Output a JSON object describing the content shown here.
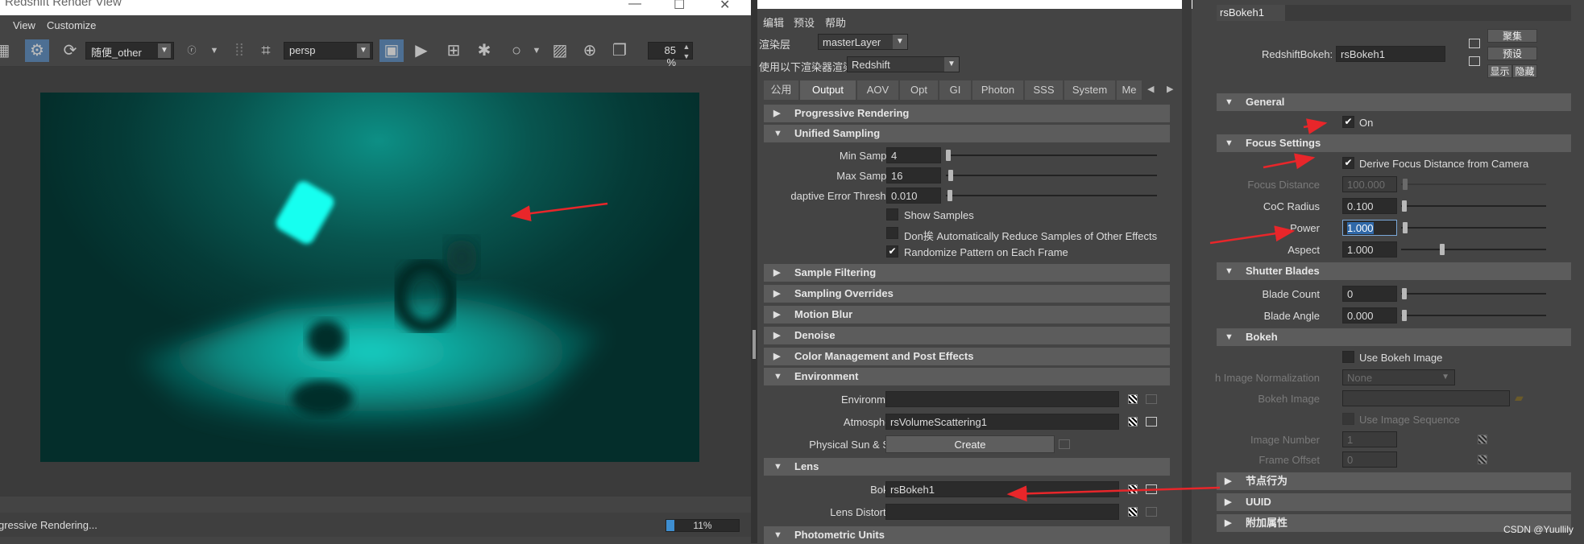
{
  "render_view": {
    "title": "Redshift Render View",
    "menu": [
      "View",
      "Customize"
    ],
    "camera_dropdown": "随便_other",
    "view_dropdown": "persp",
    "zoom": "85 %",
    "status": "gressive Rendering...",
    "progress_label": "11%",
    "progress_value": 0.11
  },
  "render_settings": {
    "menu": [
      "编辑",
      "预设",
      "帮助"
    ],
    "layer_label": "渲染层",
    "layer_value": "masterLayer",
    "renderer_label": "使用以下渲染器渲染",
    "renderer_value": "Redshift",
    "tabs": [
      "公用",
      "Output",
      "AOV",
      "Opt",
      "GI",
      "Photon",
      "SSS",
      "System",
      "Me"
    ],
    "active_tab": "Output",
    "sections": {
      "progressive": "Progressive Rendering",
      "unified": "Unified Sampling",
      "sample_filtering": "Sample Filtering",
      "sampling_overrides": "Sampling Overrides",
      "motion_blur": "Motion Blur",
      "denoise": "Denoise",
      "color_mgmt": "Color Management and Post Effects",
      "environment": "Environment",
      "lens": "Lens",
      "photometric": "Photometric Units"
    },
    "unified": {
      "min_label": "Min Samples",
      "min_value": "4",
      "max_label": "Max Samples",
      "max_value": "16",
      "thr_label": "daptive Error Threshold",
      "thr_value": "0.010",
      "show_samples": "Show Samples",
      "dont_reduce": "Don挨 Automatically Reduce Samples of Other Effects",
      "randomize": "Randomize Pattern on Each Frame"
    },
    "environment": {
      "env_label": "Environment",
      "env_value": "",
      "atm_label": "Atmosphere",
      "atm_value": "rsVolumeScattering1",
      "sun_label": "Physical Sun & Sky",
      "create_label": "Create"
    },
    "lens": {
      "bokeh_label": "Bokeh",
      "bokeh_value": "rsBokeh1",
      "distortion_label": "Lens Distortion",
      "distortion_value": ""
    }
  },
  "attribute_editor": {
    "tab": "rsBokeh1",
    "node_label": "RedshiftBokeh:",
    "node_value": "rsBokeh1",
    "buttons": {
      "focus": "聚集",
      "preset": "预设",
      "show": "显示",
      "hide": "隐藏"
    },
    "sections": {
      "general": "General",
      "focus": "Focus Settings",
      "shutter": "Shutter Blades",
      "bokeh": "Bokeh",
      "node_behavior": "节点行为",
      "uuid": "UUID",
      "extra": "附加属性"
    },
    "general": {
      "on": "On"
    },
    "focus": {
      "derive": "Derive Focus Distance from Camera",
      "dist_label": "Focus Distance",
      "dist_value": "100.000",
      "coc_label": "CoC Radius",
      "coc_value": "0.100",
      "power_label": "Power",
      "power_value": "1.000",
      "aspect_label": "Aspect",
      "aspect_value": "1.000"
    },
    "shutter": {
      "count_label": "Blade Count",
      "count_value": "0",
      "angle_label": "Blade Angle",
      "angle_value": "0.000"
    },
    "bokeh": {
      "use_image": "Use Bokeh Image",
      "norm_label": "h Image Normalization",
      "norm_value": "None",
      "image_label": "Bokeh Image",
      "image_value": "",
      "use_seq": "Use Image Sequence",
      "num_label": "Image Number",
      "num_value": "1",
      "offset_label": "Frame Offset",
      "offset_value": "0"
    },
    "watermark": "CSDN @Yuullily"
  },
  "colors": {
    "accent": "#3e8ed0",
    "annotation": "#e8262a",
    "render_glow": "#14f5ea"
  }
}
